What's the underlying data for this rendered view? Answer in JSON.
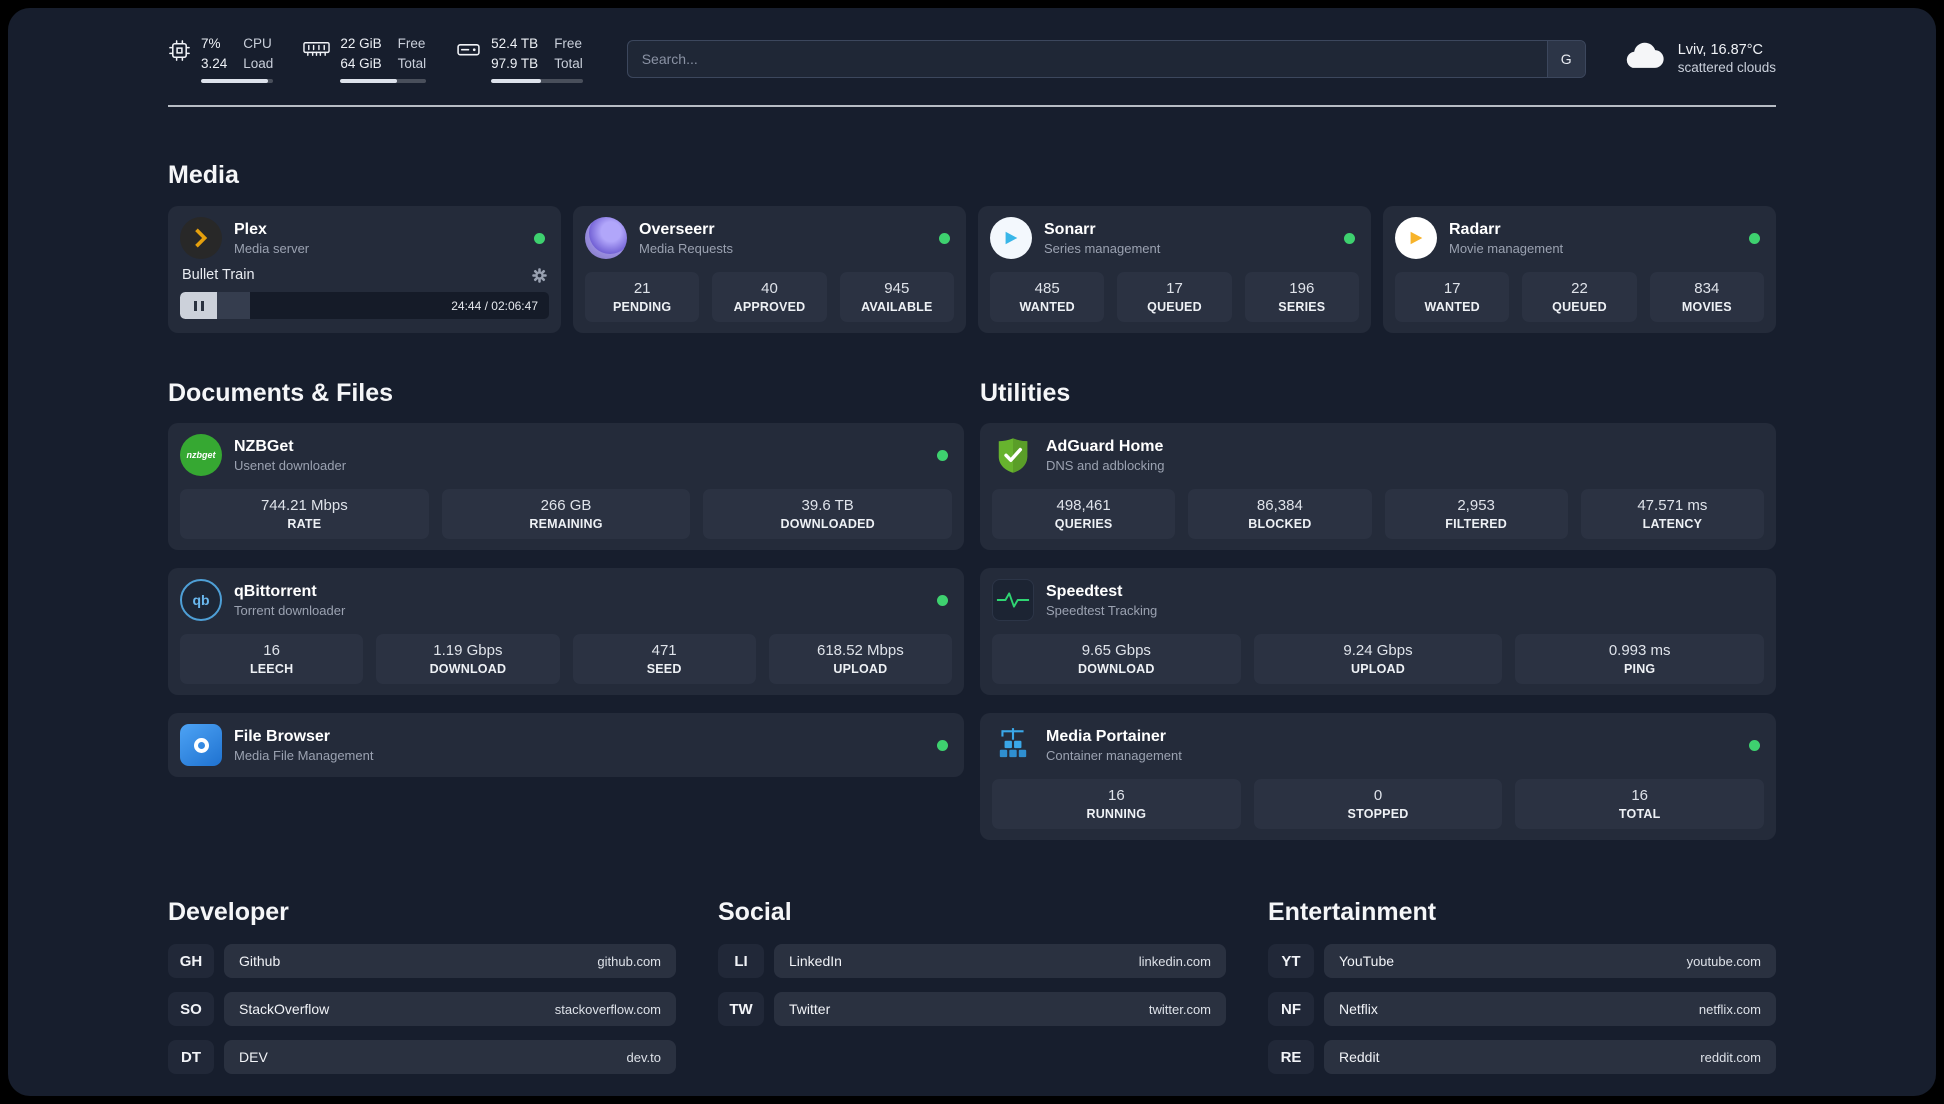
{
  "colors": {
    "background": "#171e2d",
    "card": "#242b3a",
    "stat_box": "#2b3242",
    "status_online": "#3ed16f",
    "plex_accent": "#e5a00d",
    "sonarr_accent": "#38b6e8",
    "radarr_accent": "#f7b32a",
    "nzbget_green": "#36a832",
    "adguard_green": "#67b32e",
    "speedtest_green": "#2fd573",
    "portainer_blue": "#3aa7e8"
  },
  "topbar": {
    "metrics": [
      {
        "icon": "cpu-icon",
        "row1_value": "7%",
        "row1_label": "CPU",
        "row2_value": "3.24",
        "row2_label": "Load",
        "progress": 93
      },
      {
        "icon": "ram-icon",
        "row1_value": "22 GiB",
        "row1_label": "Free",
        "row2_value": "64 GiB",
        "row2_label": "Total",
        "progress": 66
      },
      {
        "icon": "disk-icon",
        "row1_value": "52.4 TB",
        "row1_label": "Free",
        "row2_value": "97.9 TB",
        "row2_label": "Total",
        "progress": 54
      }
    ],
    "search": {
      "placeholder": "Search...",
      "engine_button": "G"
    },
    "weather": {
      "location": "Lviv, 16.87°C",
      "condition": "scattered clouds"
    }
  },
  "media": {
    "title": "Media",
    "cards": [
      {
        "name": "Plex",
        "subtitle": "Media server",
        "online": true,
        "player": {
          "title": "Bullet Train",
          "time": "24:44 / 02:06:47",
          "progress": 19
        }
      },
      {
        "name": "Overseerr",
        "subtitle": "Media Requests",
        "online": true,
        "stats": [
          {
            "value": "21",
            "label": "PENDING"
          },
          {
            "value": "40",
            "label": "APPROVED"
          },
          {
            "value": "945",
            "label": "AVAILABLE"
          }
        ]
      },
      {
        "name": "Sonarr",
        "subtitle": "Series management",
        "online": true,
        "stats": [
          {
            "value": "485",
            "label": "WANTED"
          },
          {
            "value": "17",
            "label": "QUEUED"
          },
          {
            "value": "196",
            "label": "SERIES"
          }
        ]
      },
      {
        "name": "Radarr",
        "subtitle": "Movie management",
        "online": true,
        "stats": [
          {
            "value": "17",
            "label": "WANTED"
          },
          {
            "value": "22",
            "label": "QUEUED"
          },
          {
            "value": "834",
            "label": "MOVIES"
          }
        ]
      }
    ]
  },
  "documents": {
    "title": "Documents & Files",
    "cards": [
      {
        "name": "NZBGet",
        "subtitle": "Usenet downloader",
        "online": true,
        "icon_text": "nzbget",
        "stats": [
          {
            "value": "744.21 Mbps",
            "label": "RATE"
          },
          {
            "value": "266 GB",
            "label": "REMAINING"
          },
          {
            "value": "39.6 TB",
            "label": "DOWNLOADED"
          }
        ]
      },
      {
        "name": "qBittorrent",
        "subtitle": "Torrent downloader",
        "online": true,
        "icon_text": "qb",
        "stats": [
          {
            "value": "16",
            "label": "LEECH"
          },
          {
            "value": "1.19 Gbps",
            "label": "DOWNLOAD"
          },
          {
            "value": "471",
            "label": "SEED"
          },
          {
            "value": "618.52 Mbps",
            "label": "UPLOAD"
          }
        ]
      },
      {
        "name": "File Browser",
        "subtitle": "Media File Management",
        "online": true,
        "stats": []
      }
    ]
  },
  "utilities": {
    "title": "Utilities",
    "cards": [
      {
        "name": "AdGuard Home",
        "subtitle": "DNS and adblocking",
        "online": false,
        "stats": [
          {
            "value": "498,461",
            "label": "QUERIES"
          },
          {
            "value": "86,384",
            "label": "BLOCKED"
          },
          {
            "value": "2,953",
            "label": "FILTERED"
          },
          {
            "value": "47.571 ms",
            "label": "LATENCY"
          }
        ]
      },
      {
        "name": "Speedtest",
        "subtitle": "Speedtest Tracking",
        "online": false,
        "stats": [
          {
            "value": "9.65 Gbps",
            "label": "DOWNLOAD"
          },
          {
            "value": "9.24 Gbps",
            "label": "UPLOAD"
          },
          {
            "value": "0.993 ms",
            "label": "PING"
          }
        ]
      },
      {
        "name": "Media Portainer",
        "subtitle": "Container management",
        "online": true,
        "stats": [
          {
            "value": "16",
            "label": "RUNNING"
          },
          {
            "value": "0",
            "label": "STOPPED"
          },
          {
            "value": "16",
            "label": "TOTAL"
          }
        ]
      }
    ]
  },
  "bookmarks": [
    {
      "title": "Developer",
      "items": [
        {
          "abbr": "GH",
          "name": "Github",
          "url": "github.com"
        },
        {
          "abbr": "SO",
          "name": "StackOverflow",
          "url": "stackoverflow.com"
        },
        {
          "abbr": "DT",
          "name": "DEV",
          "url": "dev.to"
        }
      ]
    },
    {
      "title": "Social",
      "items": [
        {
          "abbr": "LI",
          "name": "LinkedIn",
          "url": "linkedin.com"
        },
        {
          "abbr": "TW",
          "name": "Twitter",
          "url": "twitter.com"
        }
      ]
    },
    {
      "title": "Entertainment",
      "items": [
        {
          "abbr": "YT",
          "name": "YouTube",
          "url": "youtube.com"
        },
        {
          "abbr": "NF",
          "name": "Netflix",
          "url": "netflix.com"
        },
        {
          "abbr": "RE",
          "name": "Reddit",
          "url": "reddit.com"
        }
      ]
    }
  ]
}
